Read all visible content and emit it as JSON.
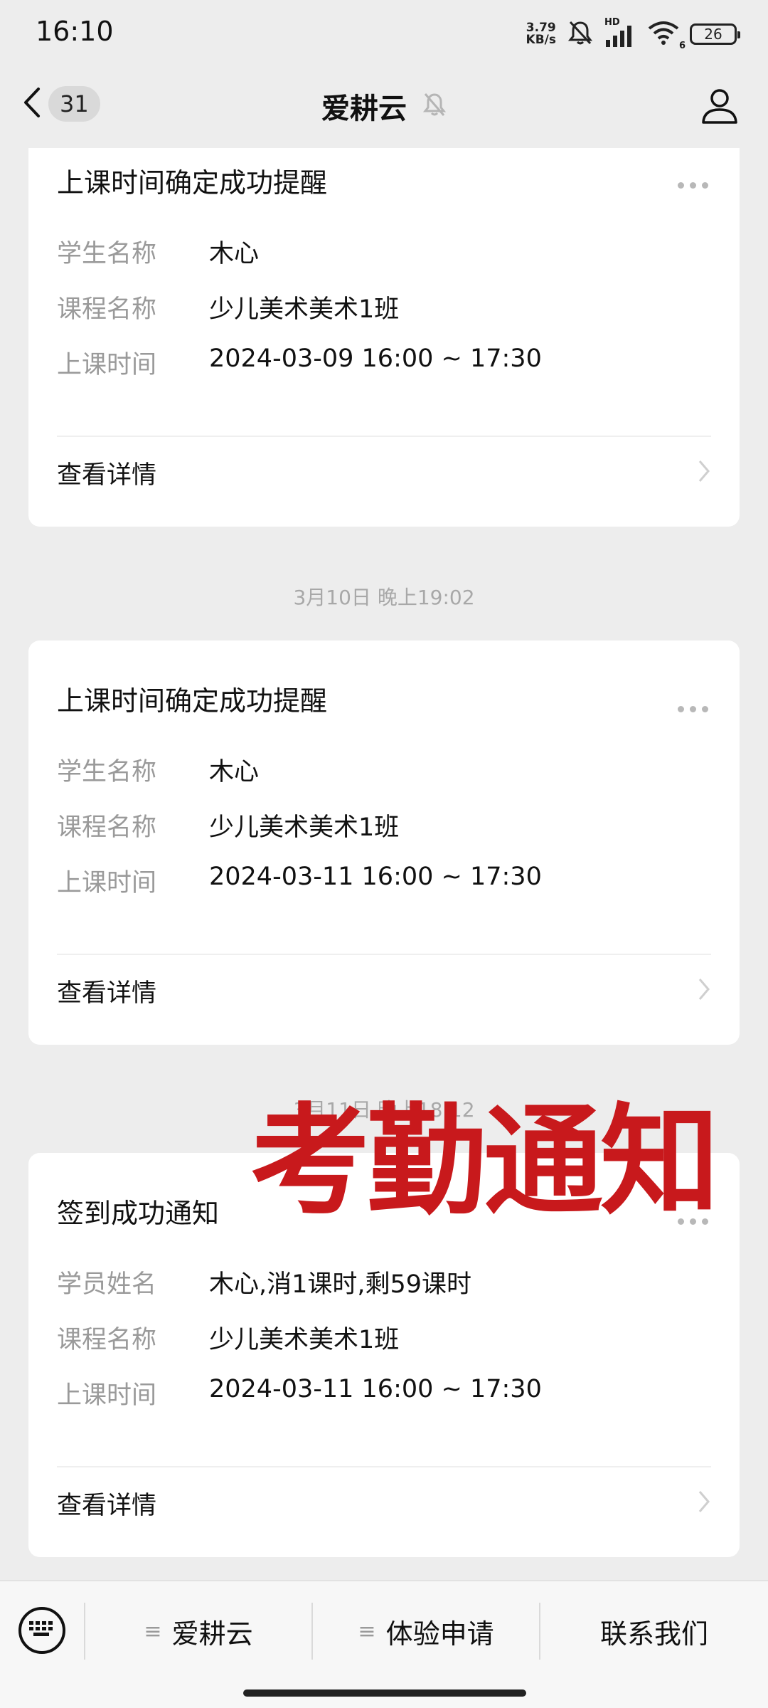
{
  "status_bar": {
    "time": "16:10",
    "net_speed_value": "3.79",
    "net_speed_unit": "KB/s",
    "signal_tag": "HD",
    "wifi_tag": "6",
    "battery": "26"
  },
  "nav": {
    "unread_count": "31",
    "title": "爱耕云"
  },
  "messages": [
    {
      "title": "上课时间确定成功提醒",
      "rows": [
        {
          "label": "学生名称",
          "value": "木心"
        },
        {
          "label": "课程名称",
          "value": "少儿美术美术1班"
        },
        {
          "label": "上课时间",
          "value": "2024-03-09 16:00 ~ 17:30"
        }
      ],
      "link": "查看详情"
    },
    {
      "timestamp": "3月10日 晚上19:02",
      "title": "上课时间确定成功提醒",
      "rows": [
        {
          "label": "学生名称",
          "value": "木心"
        },
        {
          "label": "课程名称",
          "value": "少儿美术美术1班"
        },
        {
          "label": "上课时间",
          "value": "2024-03-11 16:00 ~ 17:30"
        }
      ],
      "link": "查看详情"
    },
    {
      "timestamp": "3月11日 晚上18:12",
      "title": "签到成功通知",
      "rows": [
        {
          "label": "学员姓名",
          "value": "木心,消1课时,剩59课时"
        },
        {
          "label": "课程名称",
          "value": "少儿美术美术1班"
        },
        {
          "label": "上课时间",
          "value": "2024-03-11 16:00 ~ 17:30"
        }
      ],
      "link": "查看详情"
    }
  ],
  "overlay": "考勤通知",
  "bottom_menu": [
    {
      "label": "爱耕云",
      "glyph": "≡"
    },
    {
      "label": "体验申请",
      "glyph": "≡"
    },
    {
      "label": "联系我们"
    }
  ],
  "icons": {
    "back": "chevron-left-icon",
    "mute": "bell-muted-icon",
    "profile": "person-icon",
    "more": "more-dots-icon",
    "chevron": "chevron-right-icon",
    "keyboard": "keyboard-icon",
    "accent": "#C8191C"
  }
}
